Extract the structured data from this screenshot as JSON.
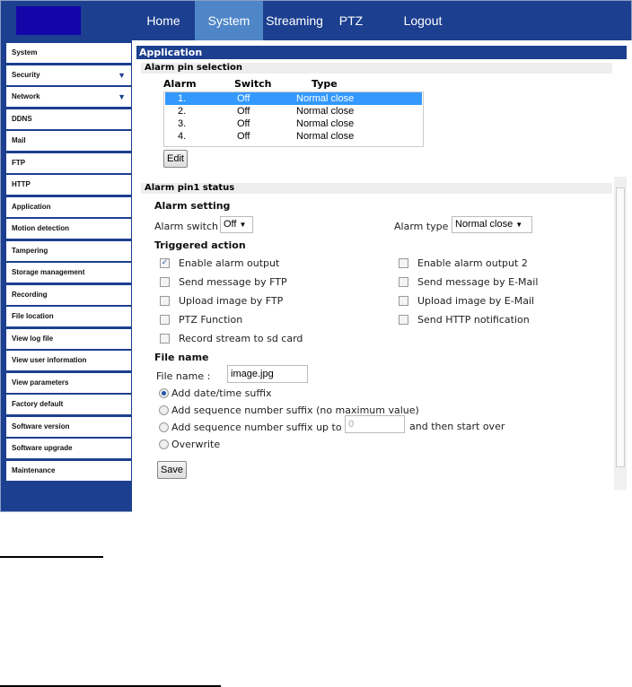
{
  "nav": [
    "Home",
    "System",
    "Streaming",
    "PTZ",
    "Logout"
  ],
  "sidebar": [
    {
      "label": "System"
    },
    {
      "label": "Security",
      "arrow": "▼"
    },
    {
      "label": "Network",
      "arrow": "▼"
    },
    {
      "label": "DDNS"
    },
    {
      "label": "Mail"
    },
    {
      "label": "FTP"
    },
    {
      "label": "HTTP"
    },
    {
      "label": "Application"
    },
    {
      "label": "Motion detection"
    },
    {
      "label": "Tampering"
    },
    {
      "label": "Storage management"
    },
    {
      "label": "Recording"
    },
    {
      "label": "File location"
    },
    {
      "label": "View log file"
    },
    {
      "label": "View user information"
    },
    {
      "label": "View parameters"
    },
    {
      "label": "Factory default"
    },
    {
      "label": "Software version"
    },
    {
      "label": "Software upgrade"
    },
    {
      "label": "Maintenance"
    }
  ],
  "page_title": "Application",
  "pin_selection": {
    "title": "Alarm pin selection",
    "headers": [
      "Alarm",
      "Switch",
      "Type"
    ],
    "rows": [
      [
        "1.",
        "Off",
        "Normal close"
      ],
      [
        "2.",
        "Off",
        "Normal close"
      ],
      [
        "3.",
        "Off",
        "Normal close"
      ],
      [
        "4.",
        "Off",
        "Normal close"
      ]
    ],
    "edit": "Edit"
  },
  "status": {
    "title": "Alarm pin1 status",
    "alarm_setting": "Alarm setting",
    "switch_label": "Alarm switch",
    "switch_value": "Off",
    "type_label": "Alarm type",
    "type_value": "Normal close",
    "triggered": "Triggered action",
    "actions": [
      {
        "label": "Enable alarm output",
        "checked": true
      },
      {
        "label": "Enable alarm output 2",
        "checked": false
      },
      {
        "label": "Send message by FTP",
        "checked": false
      },
      {
        "label": "Send message by E-Mail",
        "checked": false
      },
      {
        "label": "Upload image by FTP",
        "checked": false
      },
      {
        "label": "Upload image by E-Mail",
        "checked": false
      },
      {
        "label": "PTZ Function",
        "checked": false
      },
      {
        "label": "Send HTTP notification",
        "checked": false
      },
      {
        "label": "Record stream to sd card",
        "checked": false
      }
    ],
    "file_name_title": "File name",
    "file_name_label": "File name :",
    "file_name_value": "image.jpg",
    "options": [
      "Add date/time suffix",
      "Add sequence number suffix (no maximum value)",
      "Add sequence number suffix up to",
      "Overwrite"
    ],
    "seq_max": "0",
    "then_start_over": "and then start over",
    "save": "Save"
  }
}
